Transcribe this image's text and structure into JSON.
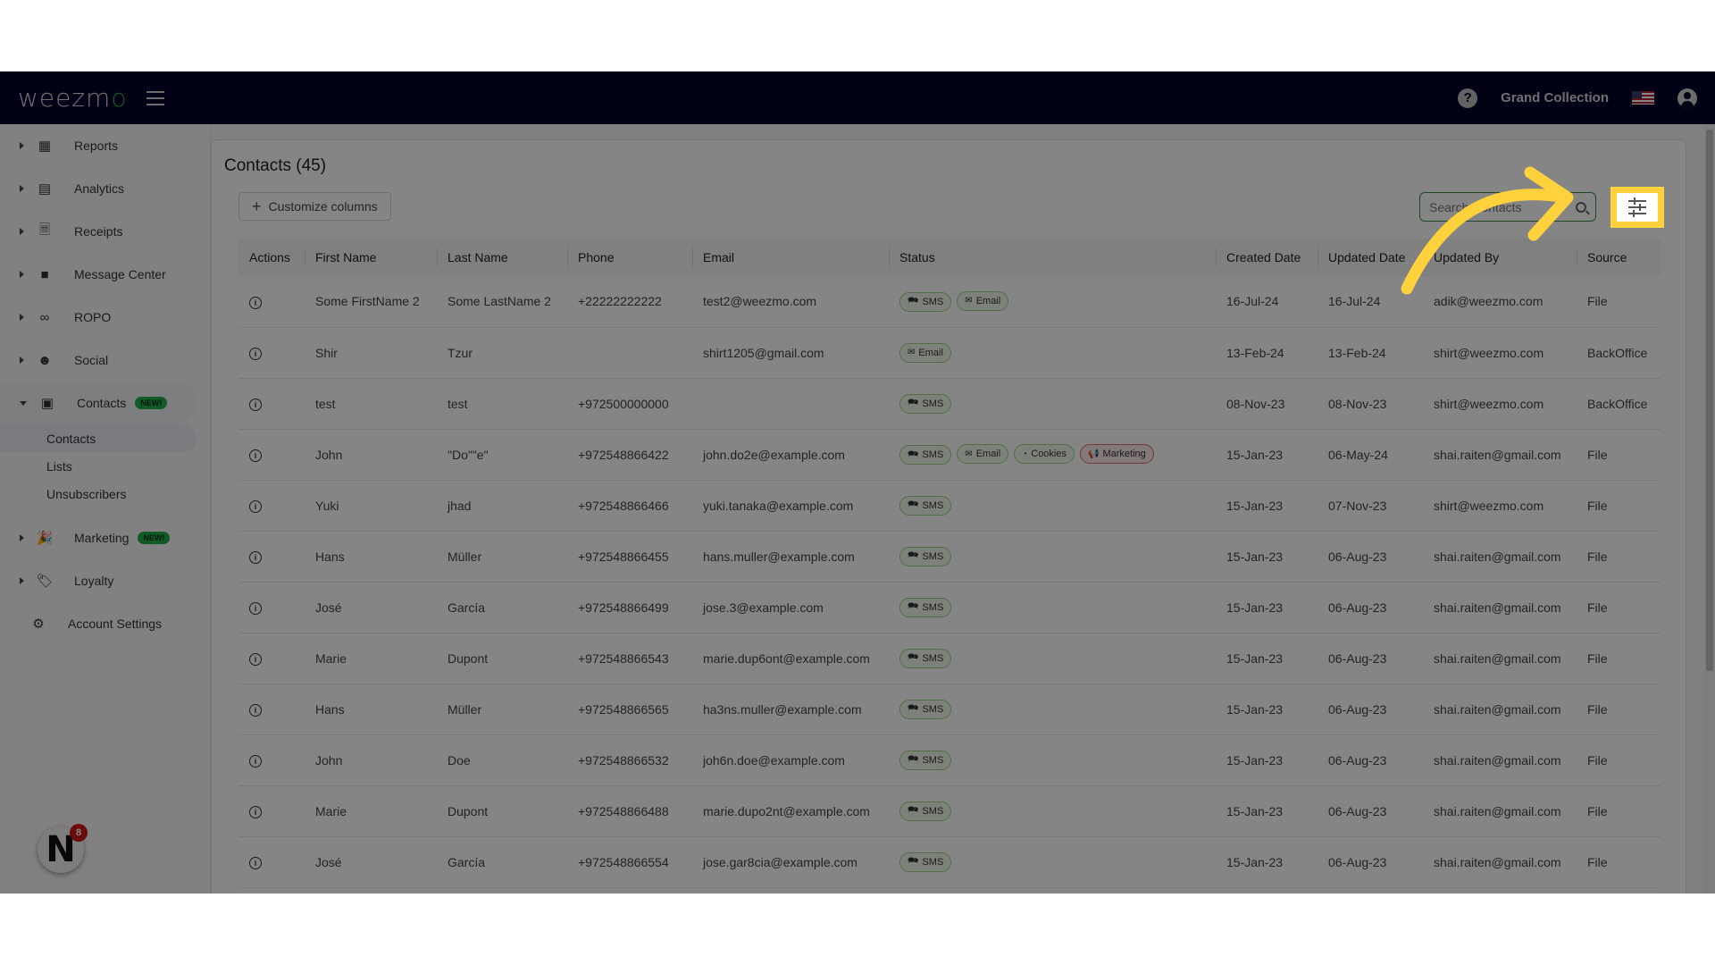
{
  "topbar": {
    "logo_main": "weezm",
    "logo_accent": "o",
    "org_name": "Grand Collection",
    "icons": {
      "help": "help-circle-icon",
      "menu": "hamburger-menu-icon",
      "flag": "us-flag-icon",
      "user": "user-account-icon"
    }
  },
  "sidebar": {
    "items": [
      {
        "label": "Reports",
        "icon": "reports-icon"
      },
      {
        "label": "Analytics",
        "icon": "analytics-icon"
      },
      {
        "label": "Receipts",
        "icon": "receipts-icon"
      },
      {
        "label": "Message Center",
        "icon": "message-icon"
      },
      {
        "label": "ROPO",
        "icon": "infinity-icon"
      },
      {
        "label": "Social",
        "icon": "social-group-icon"
      },
      {
        "label": "Contacts",
        "icon": "contacts-icon",
        "badge": "NEW!",
        "expanded": true,
        "children": [
          {
            "label": "Contacts",
            "active": true
          },
          {
            "label": "Lists"
          },
          {
            "label": "Unsubscribers"
          }
        ]
      },
      {
        "label": "Marketing",
        "icon": "marketing-icon",
        "badge": "NEW!"
      },
      {
        "label": "Loyalty",
        "icon": "loyalty-tag-icon"
      },
      {
        "label": "Account Settings",
        "icon": "gear-icon"
      }
    ],
    "avatar_letter": "N",
    "avatar_badge": "8"
  },
  "main": {
    "title": "Contacts (45)",
    "customize_label": "Customize columns",
    "search_placeholder": "Search Contacts",
    "columns": [
      "Actions",
      "First Name",
      "Last Name",
      "Phone",
      "Email",
      "Status",
      "Created Date",
      "Updated Date",
      "Updated By",
      "Source"
    ],
    "rows": [
      {
        "first": "Some FirstName 2",
        "last": "Some LastName 2",
        "phone": "+22222222222",
        "email": "test2@weezmo.com",
        "status": [
          "SMS",
          "Email"
        ],
        "created": "16-Jul-24",
        "updated": "16-Jul-24",
        "by": "adik@weezmo.com",
        "source": "File"
      },
      {
        "first": "Shir",
        "last": "Tzur",
        "phone": "",
        "email": "shirt1205@gmail.com",
        "status": [
          "Email"
        ],
        "created": "13-Feb-24",
        "updated": "13-Feb-24",
        "by": "shirt@weezmo.com",
        "source": "BackOffice"
      },
      {
        "first": "test",
        "last": "test",
        "phone": "+972500000000",
        "email": "",
        "status": [
          "SMS"
        ],
        "created": "08-Nov-23",
        "updated": "08-Nov-23",
        "by": "shirt@weezmo.com",
        "source": "BackOffice"
      },
      {
        "first": "John",
        "last": "\"Do\"\"e\"",
        "phone": "+972548866422",
        "email": "john.do2e@example.com",
        "status": [
          "SMS",
          "Email",
          "Cookies",
          "Marketing"
        ],
        "created": "15-Jan-23",
        "updated": "06-May-24",
        "by": "shai.raiten@gmail.com",
        "source": "File"
      },
      {
        "first": "Yuki",
        "last": "jhad",
        "phone": "+972548866466",
        "email": "yuki.tanaka@example.com",
        "status": [
          "SMS"
        ],
        "created": "15-Jan-23",
        "updated": "07-Nov-23",
        "by": "shirt@weezmo.com",
        "source": "File"
      },
      {
        "first": "Hans",
        "last": "Müller",
        "phone": "+972548866455",
        "email": "hans.muller@example.com",
        "status": [
          "SMS"
        ],
        "created": "15-Jan-23",
        "updated": "06-Aug-23",
        "by": "shai.raiten@gmail.com",
        "source": "File"
      },
      {
        "first": "José",
        "last": "García",
        "phone": "+972548866499",
        "email": "jose.3@example.com",
        "status": [
          "SMS"
        ],
        "created": "15-Jan-23",
        "updated": "06-Aug-23",
        "by": "shai.raiten@gmail.com",
        "source": "File"
      },
      {
        "first": "Marie",
        "last": "Dupont",
        "phone": "+972548866543",
        "email": "marie.dup6ont@example.com",
        "status": [
          "SMS"
        ],
        "created": "15-Jan-23",
        "updated": "06-Aug-23",
        "by": "shai.raiten@gmail.com",
        "source": "File"
      },
      {
        "first": "Hans",
        "last": "Müller",
        "phone": "+972548866565",
        "email": "ha3ns.muller@example.com",
        "status": [
          "SMS"
        ],
        "created": "15-Jan-23",
        "updated": "06-Aug-23",
        "by": "shai.raiten@gmail.com",
        "source": "File"
      },
      {
        "first": "John",
        "last": "Doe",
        "phone": "+972548866532",
        "email": "joh6n.doe@example.com",
        "status": [
          "SMS"
        ],
        "created": "15-Jan-23",
        "updated": "06-Aug-23",
        "by": "shai.raiten@gmail.com",
        "source": "File"
      },
      {
        "first": "Marie",
        "last": "Dupont",
        "phone": "+972548866488",
        "email": "marie.dupo2nt@example.com",
        "status": [
          "SMS"
        ],
        "created": "15-Jan-23",
        "updated": "06-Aug-23",
        "by": "shai.raiten@gmail.com",
        "source": "File"
      },
      {
        "first": "José",
        "last": "García",
        "phone": "+972548866554",
        "email": "jose.gar8cia@example.com",
        "status": [
          "SMS"
        ],
        "created": "15-Jan-23",
        "updated": "06-Aug-23",
        "by": "shai.raiten@gmail.com",
        "source": "File"
      }
    ]
  },
  "status_chip_icons": {
    "SMS": "chat-bubbles-icon",
    "Email": "envelope-icon",
    "Cookies": "cookie-icon",
    "Marketing": "megaphone-icon"
  },
  "colors": {
    "topbar_bg": "#03032a",
    "brand_green": "#22b14c",
    "highlight_yellow": "#ffd13c",
    "chip_green_border": "#9ed48a",
    "chip_red_border": "#e06a6a",
    "badge_new": "#1fae4b"
  },
  "annotation": {
    "target": "filter-settings-button"
  }
}
